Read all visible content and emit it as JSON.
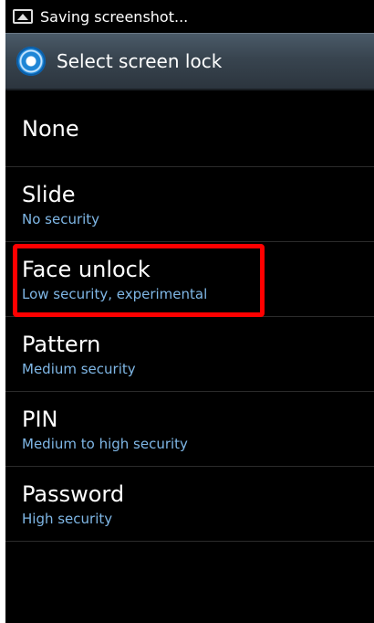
{
  "status_bar": {
    "icon": "screenshot-icon",
    "text": "Saving screenshot..."
  },
  "header": {
    "icon": "gear-icon",
    "title": "Select screen lock"
  },
  "options": [
    {
      "title": "None",
      "subtitle": ""
    },
    {
      "title": "Slide",
      "subtitle": "No security"
    },
    {
      "title": "Face unlock",
      "subtitle": "Low security, experimental"
    },
    {
      "title": "Pattern",
      "subtitle": "Medium security"
    },
    {
      "title": "PIN",
      "subtitle": "Medium to high security"
    },
    {
      "title": "Password",
      "subtitle": "High security"
    }
  ],
  "colors": {
    "background": "#000000",
    "subtitle": "#7fb7e6",
    "highlight": "#ff0000"
  }
}
